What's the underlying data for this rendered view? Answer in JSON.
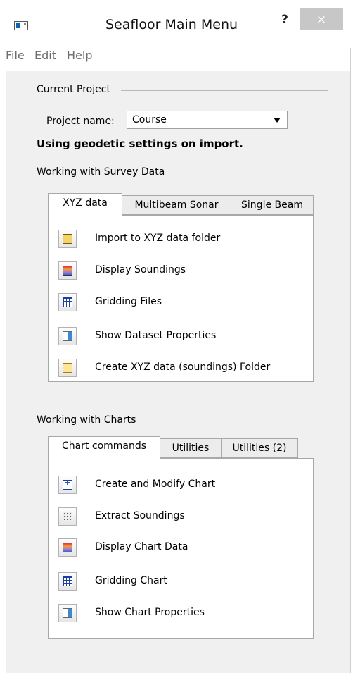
{
  "window": {
    "title": "Seafloor Main Menu",
    "help_label": "?",
    "close_label": "×"
  },
  "menu": [
    "File",
    "Edit",
    "Help"
  ],
  "current_project": {
    "group_label": "Current Project",
    "project_label": "Project name:",
    "project_value": "Course",
    "note": "Using geodetic settings on import."
  },
  "survey": {
    "group_label": "Working with Survey Data",
    "tabs": [
      "XYZ data",
      "Multibeam Sonar",
      "Single Beam"
    ],
    "active_tab": "XYZ data",
    "commands": [
      {
        "label": "Import to XYZ data folder",
        "icon": "folder-open-icon"
      },
      {
        "label": "Display Soundings",
        "icon": "soundings-icon"
      },
      {
        "label": "Gridding Files",
        "icon": "grid-icon"
      },
      {
        "label": "Show Dataset Properties",
        "icon": "properties-icon"
      },
      {
        "label": "Create XYZ data (soundings) Folder",
        "icon": "folder-icon"
      }
    ]
  },
  "charts": {
    "group_label": "Working with Charts",
    "tabs": [
      "Chart commands",
      "Utilities",
      "Utilities (2)"
    ],
    "active_tab": "Chart commands",
    "commands": [
      {
        "label": "Create and Modify Chart",
        "icon": "new-chart-icon"
      },
      {
        "label": "Extract Soundings",
        "icon": "extract-soundings-icon"
      },
      {
        "label": "Display Chart Data",
        "icon": "soundings-icon"
      },
      {
        "label": "Gridding Chart",
        "icon": "grid-icon"
      },
      {
        "label": "Show Chart Properties",
        "icon": "properties-icon"
      }
    ]
  }
}
